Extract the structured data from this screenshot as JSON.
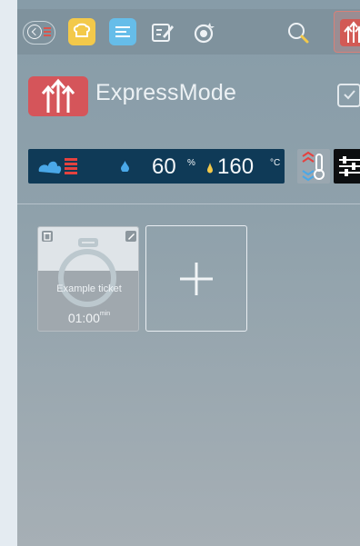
{
  "toolbar": {
    "icons": [
      "back-icon",
      "chef-hat-icon",
      "recipe-list-icon",
      "edit-icon",
      "cleaning-icon",
      "search-icon",
      "express-mode-icon"
    ]
  },
  "header": {
    "title": "ExpressMode"
  },
  "status": {
    "humidity_value": "60",
    "humidity_unit": "%",
    "temperature_value": "160",
    "temperature_unit": "°C"
  },
  "tickets": [
    {
      "name": "Example ticket",
      "time": "01:00",
      "time_unit": "min"
    }
  ],
  "colors": {
    "background": "#e4ebf1",
    "status_bar": "#0f3a57",
    "accent_red": "#d5555a",
    "yellow": "#f3c94a",
    "blue": "#66bde9"
  }
}
